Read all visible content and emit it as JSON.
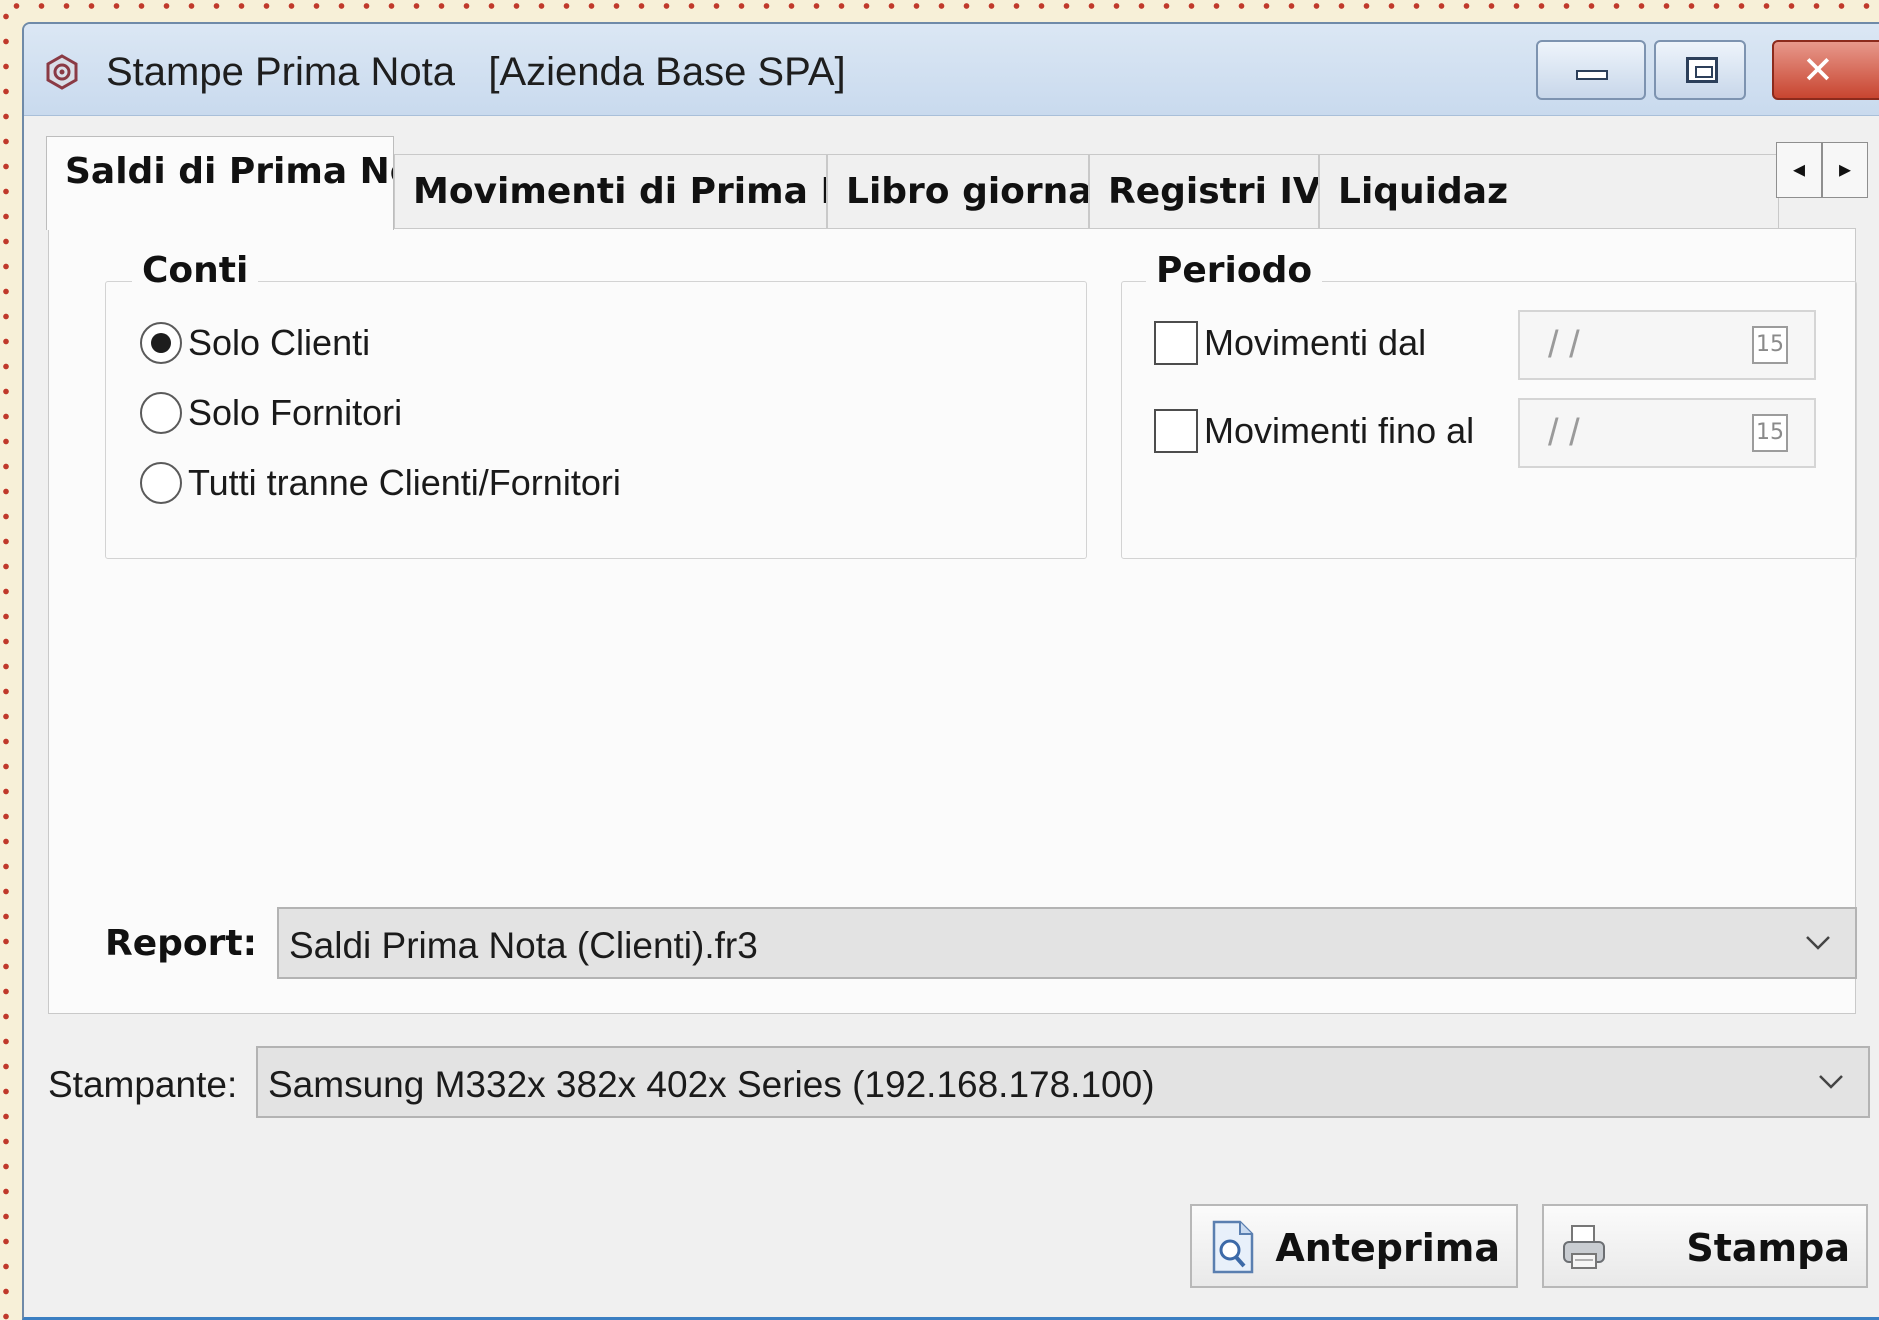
{
  "window": {
    "title": "Stampe Prima Nota   [Azienda Base SPA]",
    "icon": "app-logo-icon",
    "controls": {
      "minimize": "window-minimize-icon",
      "maximize": "window-restore-icon",
      "close_glyph": "✕"
    }
  },
  "tabs": [
    {
      "label": "Saldi di Prima Nota",
      "active": true
    },
    {
      "label": "Movimenti di Prima Nota",
      "active": false
    },
    {
      "label": "Libro giornale",
      "active": false
    },
    {
      "label": "Registri IVA",
      "active": false
    },
    {
      "label": "Liquidaz",
      "active": false
    }
  ],
  "tab_scroll": {
    "left": "◂",
    "right": "▸"
  },
  "conti": {
    "legend": "Conti",
    "options": [
      {
        "label": "Solo Clienti",
        "selected": true
      },
      {
        "label": "Solo Fornitori",
        "selected": false
      },
      {
        "label": "Tutti tranne Clienti/Fornitori",
        "selected": false
      }
    ]
  },
  "periodo": {
    "legend": "Periodo",
    "from": {
      "label": "Movimenti dal",
      "checked": false,
      "value": "/ /",
      "calendar_badge": "15"
    },
    "to": {
      "label": "Movimenti fino al",
      "checked": false,
      "value": "/ /",
      "calendar_badge": "15"
    }
  },
  "report": {
    "label": "Report:",
    "selected": "Saldi Prima Nota (Clienti).fr3"
  },
  "printer": {
    "label": "Stampante:",
    "selected": "Samsung M332x 382x 402x Series (192.168.178.100)"
  },
  "buttons": {
    "preview": "Anteprima",
    "print": "Stampa"
  },
  "colors": {
    "titlebar": "#c9daee",
    "close_button": "#c84530",
    "frame_accent": "#3b7fc2",
    "page_background": "#f7f0d8",
    "dotted_border": "#c0392b"
  }
}
